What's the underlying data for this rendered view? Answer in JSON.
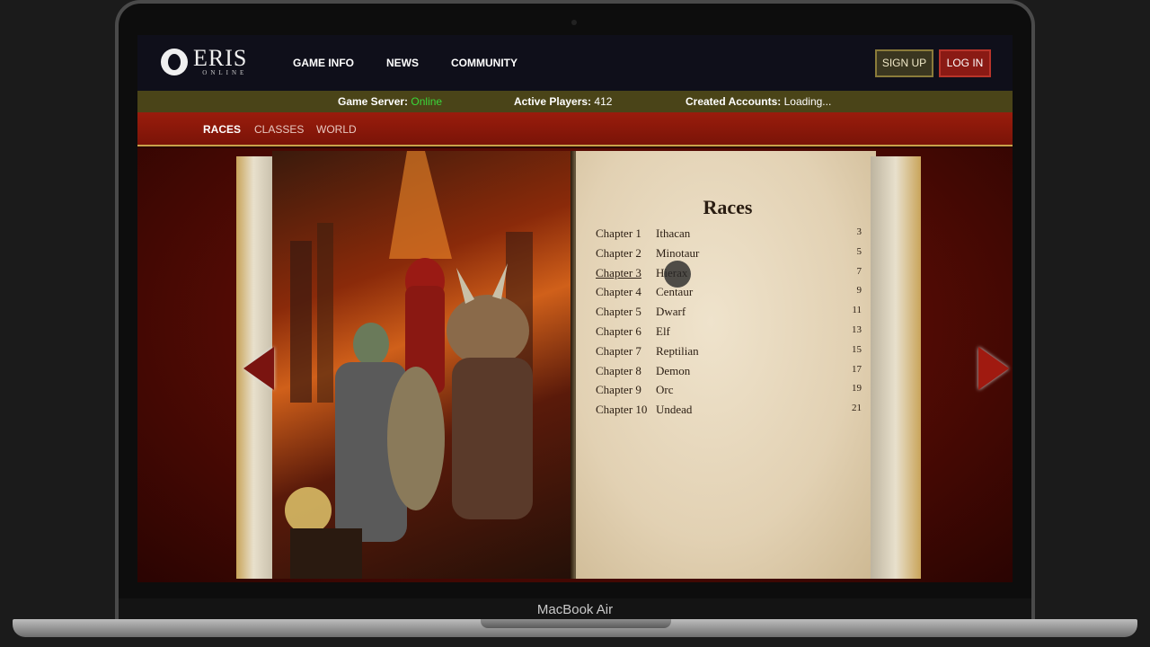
{
  "device": {
    "model_label": "MacBook Air"
  },
  "site": {
    "logo": {
      "word": "ERIS",
      "sub": "ONLINE"
    },
    "nav": [
      "GAME INFO",
      "NEWS",
      "COMMUNITY"
    ],
    "signup_label": "SIGN UP",
    "login_label": "LOG IN"
  },
  "status": {
    "server_label": "Game Server:",
    "server_value": "Online",
    "players_label": "Active Players:",
    "players_value": "412",
    "accounts_label": "Created Accounts:",
    "accounts_value": "Loading..."
  },
  "sub_nav": [
    "RACES",
    "CLASSES",
    "WORLD"
  ],
  "sub_nav_active": "RACES",
  "book": {
    "title": "Races",
    "toc": [
      {
        "chapter": "Chapter 1",
        "race": "Ithacan",
        "page": "3"
      },
      {
        "chapter": "Chapter 2",
        "race": "Minotaur",
        "page": "5"
      },
      {
        "chapter": "Chapter 3",
        "race": "Hierax",
        "page": "7"
      },
      {
        "chapter": "Chapter 4",
        "race": "Centaur",
        "page": "9"
      },
      {
        "chapter": "Chapter 5",
        "race": "Dwarf",
        "page": "11"
      },
      {
        "chapter": "Chapter 6",
        "race": "Elf",
        "page": "13"
      },
      {
        "chapter": "Chapter 7",
        "race": "Reptilian",
        "page": "15"
      },
      {
        "chapter": "Chapter 8",
        "race": "Demon",
        "page": "17"
      },
      {
        "chapter": "Chapter 9",
        "race": "Orc",
        "page": "19"
      },
      {
        "chapter": "Chapter 10",
        "race": "Undead",
        "page": "21"
      }
    ]
  },
  "colors": {
    "accent_red": "#8a1a14",
    "online_green": "#3ad83a",
    "status_bar": "#4a4418",
    "parchment": "#e2d1b3"
  }
}
